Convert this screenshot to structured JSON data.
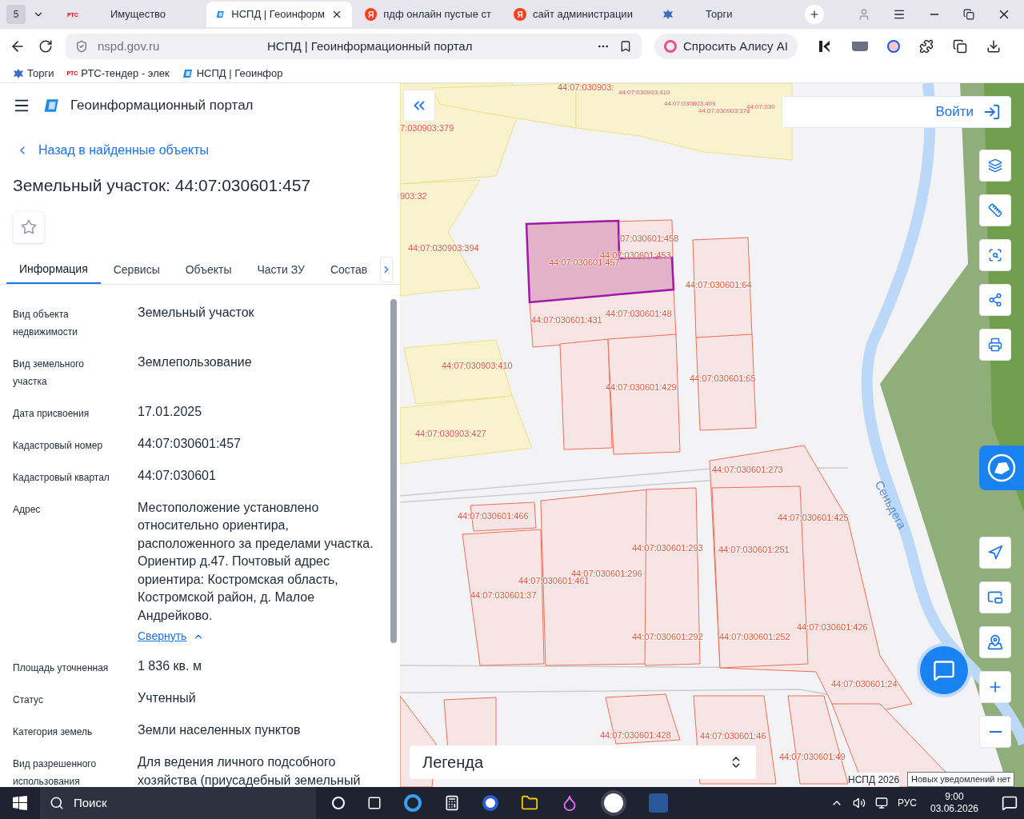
{
  "browser": {
    "tab_count": "5",
    "tabs": [
      {
        "kind": "rts",
        "icon_text": "РТС",
        "title": "Имущество",
        "selected": false
      },
      {
        "kind": "portal",
        "title": "НСПД | Геоинформ",
        "selected": true
      },
      {
        "kind": "search",
        "icon_text": "Я",
        "title": "пдф онлайн пустые ст",
        "selected": false
      },
      {
        "kind": "search",
        "icon_text": "Я",
        "title": "сайт администрации",
        "selected": false
      },
      {
        "kind": "emblem",
        "title": "Торги",
        "selected": false
      }
    ],
    "address": "nspd.gov.ru",
    "page_title": "НСПД | Геоинформационный портал",
    "alice": "Спросить Алису AI",
    "bookmarks": [
      {
        "kind": "emblem",
        "title": "Торги"
      },
      {
        "kind": "rts",
        "icon_text": "РТС",
        "title": "РТС-тендер - элек"
      },
      {
        "kind": "portal",
        "title": "НСПД | Геоинфор"
      }
    ]
  },
  "panel": {
    "portal_title": "Геоинформационный портал",
    "back_link": "Назад в найденные объекты",
    "heading": "Земельный участок: 44:07:030601:457",
    "favorite": false,
    "tabs": [
      {
        "label": "Информация",
        "selected": true
      },
      {
        "label": "Сервисы",
        "selected": false
      },
      {
        "label": "Объекты",
        "selected": false
      },
      {
        "label": "Части ЗУ",
        "selected": false
      },
      {
        "label": "Состав",
        "selected": false
      }
    ],
    "fields": [
      {
        "label": "Вид объекта недвижимости",
        "value": "Земельный участок"
      },
      {
        "label": "Вид земельного участка",
        "value": "Землепользование"
      },
      {
        "label": "Дата присвоения",
        "value": "17.01.2025"
      },
      {
        "label": "Кадастровый номер",
        "value": "44:07:030601:457"
      },
      {
        "label": "Кадастровый квартал",
        "value": "44:07:030601"
      },
      {
        "label": "Адрес",
        "value": "Местоположение установлено относительно ориентира, расположенного за пределами участка. Ориентир д.47. Почтовый адрес ориентира: Костромская область, Костромской район, д. Малое Андрейково.",
        "link": "Свернуть"
      },
      {
        "label": "Площадь уточненная",
        "value": "1 836 кв. м"
      },
      {
        "label": "Статус",
        "value": "Учтенный"
      },
      {
        "label": "Категория земель",
        "value": "Земли населенных пунктов"
      },
      {
        "label": "Вид разрешенного использования",
        "value": "Для ведения личного подсобного хозяйства (приусадебный земельный"
      }
    ]
  },
  "map": {
    "login": "Войти",
    "legend": "Легенда",
    "copyright": "НСПД 2026",
    "notice": "Новых уведомлений нет",
    "river": "Сеньдега",
    "labels": [
      "44:07:030903:",
      "44:07:030903:410",
      "44:07:030803:409",
      "44:07:030903:378",
      "44:07:030",
      "7:030903:379",
      "903:32",
      "44:07:030903:394",
      "07:030601:458",
      "44:07:030601:453",
      "44:07:030601:457",
      "44:07:030601:64",
      "44:07:030601:431",
      "44:07:030601:48",
      "44:07:030903:410",
      "44:07:030601:429",
      "44:07:030601:65",
      "44:07:030903:427",
      "44:07:030601:273",
      "44:07:030601:466",
      "44:07:030601:425",
      "44:07:030601:293",
      "44:07:030601:251",
      "44:07:030601:296",
      "44:07:030601:461",
      "44:07:030601:37",
      "44:07:030601:292",
      "44:07:030601:252",
      "44:07:030601:426",
      "44:07:030601:24",
      "44:07:030601:428",
      "44:07:030601:46",
      "44:07:030601:49"
    ]
  },
  "taskbar": {
    "search": "Поиск",
    "lang": "РУС",
    "time": "9:00",
    "date": "03.06.2026"
  }
}
